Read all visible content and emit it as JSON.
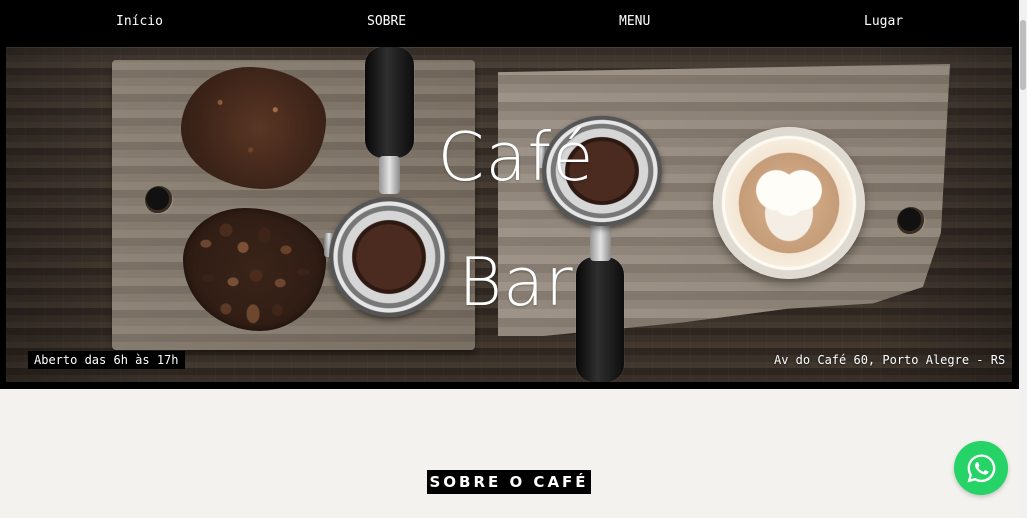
{
  "nav": {
    "items": [
      {
        "label": "Início"
      },
      {
        "label": "SOBRE"
      },
      {
        "label": "MENU"
      },
      {
        "label": "Lugar"
      }
    ]
  },
  "hero": {
    "title": "Café\nBar",
    "open_hours": "Aberto das 6h às 17h",
    "address": "Av do Café 60, Porto Alegre - RS"
  },
  "section": {
    "title": "SOBRE O CAFÉ"
  },
  "floating": {
    "whatsapp_icon": "whatsapp-icon",
    "whatsapp_color": "#25d366"
  },
  "colors": {
    "nav_background": "#000000",
    "section_background": "#f3f2ef",
    "text_on_dark": "#ffffff"
  }
}
